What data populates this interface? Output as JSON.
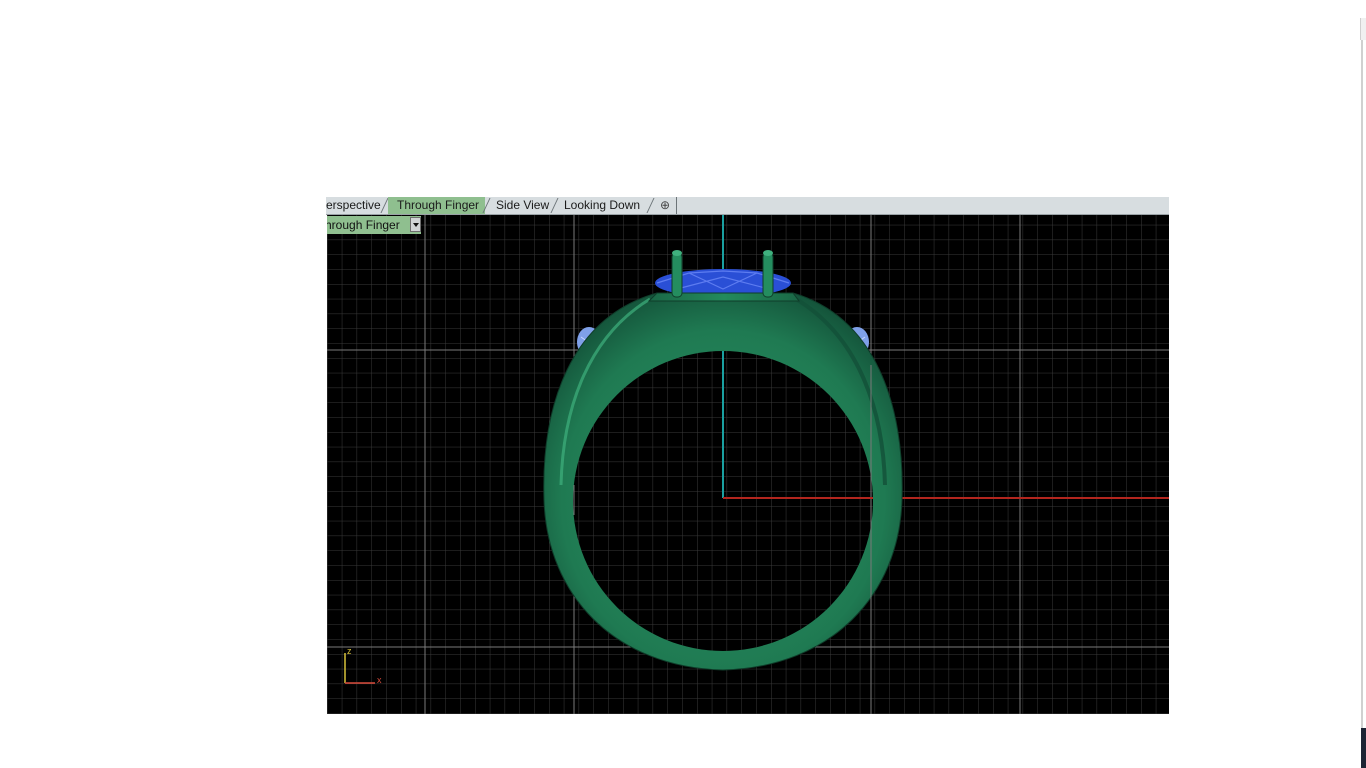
{
  "viewport_tabs": [
    {
      "label": "erspective",
      "active": false
    },
    {
      "label": "Through Finger",
      "active": true
    },
    {
      "label": "Side View",
      "active": false
    },
    {
      "label": "Looking Down",
      "active": false
    }
  ],
  "add_tab_glyph": "⊕",
  "viewport": {
    "name_label": "hrough Finger",
    "axis_labels": {
      "z": "z",
      "x": "x"
    },
    "model_color": "#1f7a52",
    "stone_color": "#2a4fd6",
    "side_stone_color": "#7fa0e8",
    "grid_color": "#3a3a3a",
    "major_grid_color": "#7a7a7a",
    "x_axis_color": "#b3261e",
    "z_axis_color": "#1aa0a0"
  },
  "icons": {
    "menu": "chevron-down-icon",
    "add": "add-viewport-icon"
  }
}
